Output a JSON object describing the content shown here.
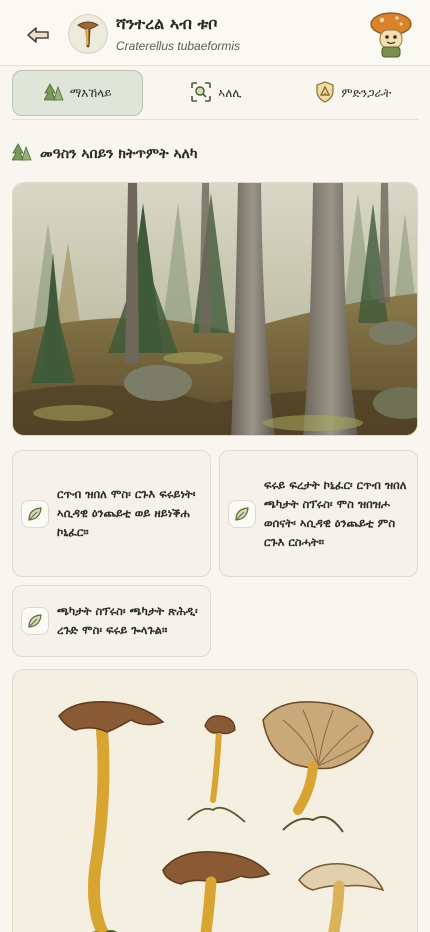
{
  "header": {
    "back_icon": "back-arrow-icon",
    "title": "ሻንተረል ኣብ ቱቦ",
    "scientific_name": "Craterellus tubaeformis",
    "avatar_icon": "mushroom-icon",
    "mascot_icon": "mushroom-mascot-icon"
  },
  "tabs": [
    {
      "label": "ማእኸላይ",
      "icon": "forest-icon",
      "active": true
    },
    {
      "label": "ኣለሊ",
      "icon": "scan-icon",
      "active": false
    },
    {
      "label": "ምድንጋራት",
      "icon": "warning-shield-icon",
      "active": false
    }
  ],
  "section": {
    "heading": "መዓስን ኣበይን ክትጥምት ኣለካ",
    "icon": "forest-icon"
  },
  "habitat_cards": [
    {
      "icon": "leaf-icon",
      "text": "ርጥብ ዝበለ ሞስ፡ ርጉእ ፍሩይነት፡ ኣሲዳዊ ዕንጨይቲ ወይ ዘይነቕሐ ኮኒፈር።"
    },
    {
      "icon": "leaf-icon",
      "text": "ፍሩይ ፍረታት ኮኒፈር፡ ርጥብ ዝበለ ጫካታት ስፕሩስ፡ ሞስ ዝበዝሖ ወሰናት፡ ኣሲዳዊ ዕንጨይቲ ምስ ርጉእ ርስሓት።"
    },
    {
      "icon": "leaf-icon",
      "text": "ጫካታት ስፕሩስ፡ ጫካታት ጽሕዲ፡ ረጉድ ሞስ፡ ፍሩይ ጐላጉል።"
    }
  ],
  "colors": {
    "background": "#f8f6ef",
    "accent_tab": "#dfe5d8",
    "card_bg": "#f4f2ea",
    "mushroom_cap": "#8a5a34",
    "mushroom_stem": "#d9a532"
  }
}
